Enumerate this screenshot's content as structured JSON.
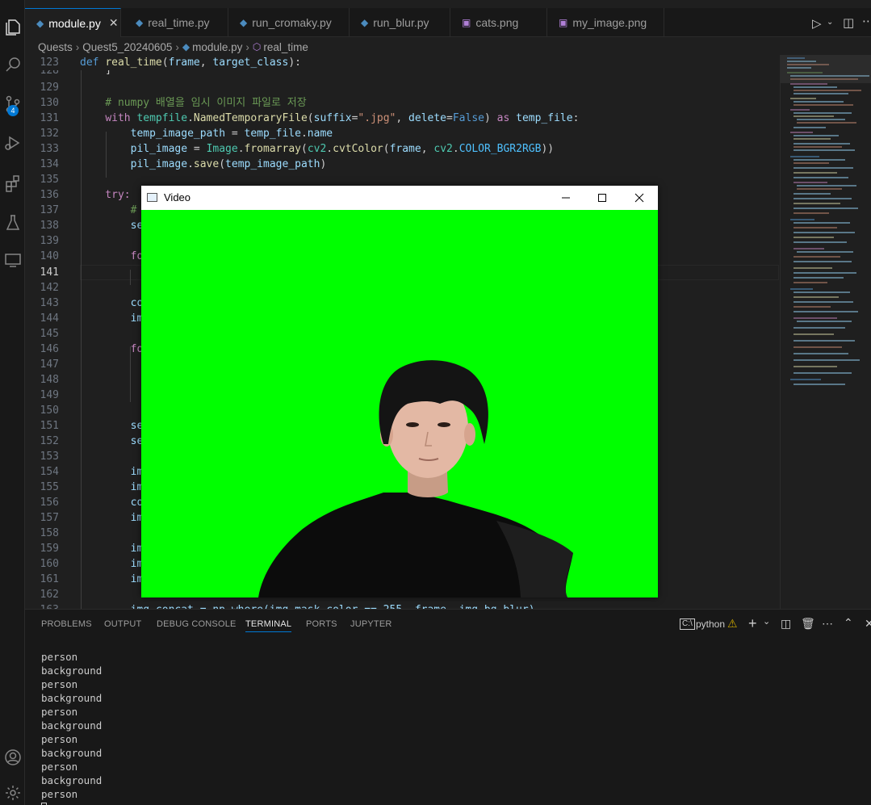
{
  "tabs": [
    {
      "label": "module.py",
      "icon": "python-file-icon",
      "active": true
    },
    {
      "label": "real_time.py",
      "icon": "python-file-icon"
    },
    {
      "label": "run_cromaky.py",
      "icon": "python-file-icon"
    },
    {
      "label": "run_blur.py",
      "icon": "python-file-icon"
    },
    {
      "label": "cats.png",
      "icon": "image-file-icon"
    },
    {
      "label": "my_image.png",
      "icon": "image-file-icon"
    }
  ],
  "breadcrumb": [
    "Quests",
    "Quest5_20240605",
    "module.py",
    "real_time"
  ],
  "activity": {
    "scm_badge": "4"
  },
  "editor": {
    "current_line": "141",
    "lines": [
      {
        "n": "123",
        "t": "def real_time(frame, target_class):"
      },
      {
        "n": "128",
        "t": "    ]"
      },
      {
        "n": "129",
        "t": ""
      },
      {
        "n": "130",
        "t": "    # numpy 배열을 임시 이미지 파일로 저장"
      },
      {
        "n": "131",
        "t": "    with tempfile.NamedTemporaryFile(suffix=\".jpg\", delete=False) as temp_file:"
      },
      {
        "n": "132",
        "t": "        temp_image_path = temp_file.name"
      },
      {
        "n": "133",
        "t": "        pil_image = Image.fromarray(cv2.cvtColor(frame, cv2.COLOR_BGR2RGB))"
      },
      {
        "n": "134",
        "t": "        pil_image.save(temp_image_path)"
      },
      {
        "n": "135",
        "t": ""
      },
      {
        "n": "136",
        "t": "    try:"
      },
      {
        "n": "137",
        "t": "        #"
      },
      {
        "n": "138",
        "t": "        se"
      },
      {
        "n": "139",
        "t": ""
      },
      {
        "n": "140",
        "t": "        fo"
      },
      {
        "n": "141",
        "t": ""
      },
      {
        "n": "142",
        "t": ""
      },
      {
        "n": "143",
        "t": "        co"
      },
      {
        "n": "144",
        "t": "        im"
      },
      {
        "n": "145",
        "t": ""
      },
      {
        "n": "146",
        "t": "        fo"
      },
      {
        "n": "147",
        "t": ""
      },
      {
        "n": "148",
        "t": ""
      },
      {
        "n": "149",
        "t": ""
      },
      {
        "n": "150",
        "t": ""
      },
      {
        "n": "151",
        "t": "        se"
      },
      {
        "n": "152",
        "t": "        se"
      },
      {
        "n": "153",
        "t": ""
      },
      {
        "n": "154",
        "t": "        im"
      },
      {
        "n": "155",
        "t": "        im"
      },
      {
        "n": "156",
        "t": "        co"
      },
      {
        "n": "157",
        "t": "        im"
      },
      {
        "n": "158",
        "t": ""
      },
      {
        "n": "159",
        "t": "        im"
      },
      {
        "n": "160",
        "t": "        im"
      },
      {
        "n": "161",
        "t": "        im"
      },
      {
        "n": "162",
        "t": ""
      },
      {
        "n": "163",
        "t": "        img_concat = np.where(img_mask_color == 255, frame, img_bg_blur)"
      }
    ]
  },
  "panel": {
    "tabs": [
      "PROBLEMS",
      "OUTPUT",
      "DEBUG CONSOLE",
      "TERMINAL",
      "PORTS",
      "JUPYTER"
    ],
    "active_tab": "TERMINAL",
    "terminal_name": "python",
    "terminal_lines": [
      "person",
      "background",
      "person",
      "background",
      "person",
      "background",
      "person",
      "background",
      "person",
      "background",
      "person"
    ]
  },
  "video_window": {
    "title": "Video",
    "background_color": "#00ff00"
  },
  "colors": {
    "accent": "#0078d4",
    "chroma": "#00ff00"
  }
}
